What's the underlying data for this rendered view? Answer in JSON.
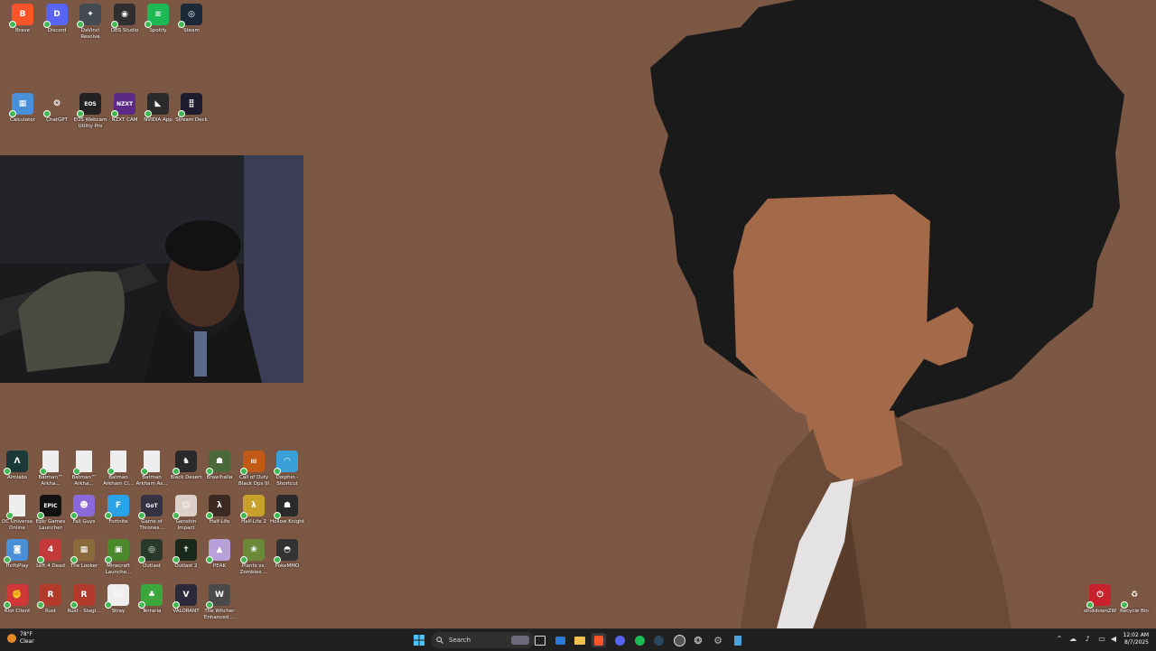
{
  "desktop": {
    "top_icons": [
      {
        "label": "Brave",
        "color": "#fb542b",
        "glyph": "B",
        "icon": "brave-icon"
      },
      {
        "label": "Discord",
        "color": "#5865f2",
        "glyph": "D",
        "icon": "discord-icon"
      },
      {
        "label": "DaVinci Resolve",
        "color": "#444a52",
        "glyph": "✦",
        "icon": "davinci-icon"
      },
      {
        "label": "OBS Studio",
        "color": "#302e31",
        "glyph": "◉",
        "icon": "obs-icon"
      },
      {
        "label": "Spotify",
        "color": "#1db954",
        "glyph": "≋",
        "icon": "spotify-icon"
      },
      {
        "label": "Steam",
        "color": "#1b2838",
        "glyph": "◎",
        "icon": "steam-icon"
      }
    ],
    "second_row_icons": [
      {
        "label": "Calculator",
        "color": "#4a90d9",
        "glyph": "▦",
        "icon": "calculator-icon"
      },
      {
        "label": "ChatGPT",
        "color": "#7b5744",
        "glyph": "❂",
        "icon": "chatgpt-icon"
      },
      {
        "label": "EOS Webcam Utility Pro",
        "color": "#222",
        "glyph": "EOS",
        "icon": "eos-webcam-icon"
      },
      {
        "label": "NZXT CAM",
        "color": "#5b2a86",
        "glyph": "NZXT",
        "icon": "nzxt-icon"
      },
      {
        "label": "NVIDIA App",
        "color": "#2b2b2b",
        "glyph": "◣",
        "icon": "nvidia-icon"
      },
      {
        "label": "Stream Deck",
        "color": "#1c1c2e",
        "glyph": "⣿",
        "icon": "stream-deck-icon"
      }
    ],
    "game_icons": [
      [
        {
          "label": "Aimlabs",
          "color": "#1a3a3a",
          "glyph": "Λ",
          "icon": "aimlabs-icon"
        },
        {
          "label": "Batman™ Arkha...",
          "color": "#eee",
          "glyph": "",
          "icon": "file-icon"
        },
        {
          "label": "Batman™ Arkha...",
          "color": "#eee",
          "glyph": "",
          "icon": "file-icon"
        },
        {
          "label": "Batman Arkham Ci...",
          "color": "#eee",
          "glyph": "",
          "icon": "file-icon"
        },
        {
          "label": "Batman Arkham As...",
          "color": "#eee",
          "glyph": "",
          "icon": "file-icon"
        },
        {
          "label": "Black Desert",
          "color": "#2a2a2a",
          "glyph": "♞",
          "icon": "black-desert-icon"
        },
        {
          "label": "Brawlhalla",
          "color": "#4a6a3a",
          "glyph": "☗",
          "icon": "brawlhalla-icon"
        },
        {
          "label": "Call of Duty Black Ops III",
          "color": "#c25a17",
          "glyph": "III",
          "icon": "cod-icon"
        },
        {
          "label": "Dolphin - Shortcut",
          "color": "#3aa0d8",
          "glyph": "◠",
          "icon": "dolphin-icon"
        }
      ],
      [
        {
          "label": "DC Universe Online",
          "color": "#eee",
          "glyph": "",
          "icon": "file-icon"
        },
        {
          "label": "Epic Games Launcher",
          "color": "#111",
          "glyph": "EPIC",
          "icon": "epic-games-icon"
        },
        {
          "label": "Fall Guys",
          "color": "#8a6ad8",
          "glyph": "☻",
          "icon": "fall-guys-icon"
        },
        {
          "label": "Fortnite",
          "color": "#2aa2e8",
          "glyph": "F",
          "icon": "fortnite-icon"
        },
        {
          "label": "Game of Thrones...",
          "color": "#334",
          "glyph": "GoT",
          "icon": "got-icon"
        },
        {
          "label": "Genshin Impact",
          "color": "#ddd0c8",
          "glyph": "☺",
          "icon": "genshin-icon"
        },
        {
          "label": "Half-Life",
          "color": "#3a2a22",
          "glyph": "λ",
          "icon": "half-life-icon"
        },
        {
          "label": "Half-Life 2",
          "color": "#c8a02a",
          "glyph": "λ",
          "icon": "half-life-2-icon"
        },
        {
          "label": "Hollow Knight",
          "color": "#2a2a2a",
          "glyph": "☗",
          "icon": "hollow-knight-icon"
        }
      ],
      [
        {
          "label": "HoYoPlay",
          "color": "#4a90d9",
          "glyph": "◙",
          "icon": "hoyoplay-icon"
        },
        {
          "label": "Left 4 Dead",
          "color": "#c23a3a",
          "glyph": "4",
          "icon": "left-4-dead-icon"
        },
        {
          "label": "The Looker",
          "color": "#8a6a3a",
          "glyph": "▦",
          "icon": "the-looker-icon"
        },
        {
          "label": "Minecraft Launche...",
          "color": "#4a8a2a",
          "glyph": "▣",
          "icon": "minecraft-icon"
        },
        {
          "label": "Outlast",
          "color": "#2a3a2a",
          "glyph": "◎",
          "icon": "outlast-icon"
        },
        {
          "label": "Outlast 2",
          "color": "#1a2a1a",
          "glyph": "✝",
          "icon": "outlast-2-icon"
        },
        {
          "label": "PEAK",
          "color": "#b8a0d8",
          "glyph": "▲",
          "icon": "peak-icon"
        },
        {
          "label": "Plants vs. Zombies ...",
          "color": "#6a8a3a",
          "glyph": "❀",
          "icon": "pvz-icon"
        },
        {
          "label": "PokeMMO",
          "color": "#333",
          "glyph": "◓",
          "icon": "pokemmo-icon"
        }
      ],
      [
        {
          "label": "Riot Client",
          "color": "#d13639",
          "glyph": "✊",
          "icon": "riot-client-icon"
        },
        {
          "label": "Rust",
          "color": "#b23a2a",
          "glyph": "R",
          "icon": "rust-icon"
        },
        {
          "label": "Rust - Stagi...",
          "color": "#b23a2a",
          "glyph": "R",
          "icon": "rust-staging-icon"
        },
        {
          "label": "Stray",
          "color": "#eee",
          "glyph": "🐱",
          "icon": "stray-icon"
        },
        {
          "label": "Terraria",
          "color": "#3aa83a",
          "glyph": "♣",
          "icon": "terraria-icon"
        },
        {
          "label": "VALORANT",
          "color": "#2a2a3a",
          "glyph": "V",
          "icon": "valorant-icon"
        },
        {
          "label": "The Witcher Enhanced ...",
          "color": "#4a4a4a",
          "glyph": "W",
          "icon": "witcher-icon"
        }
      ]
    ],
    "right_icons": [
      {
        "label": "shutdownZW",
        "color": "#c8232c",
        "glyph": "⏻",
        "icon": "shutdown-icon"
      },
      {
        "label": "Recycle Bin",
        "color": "#7b5744",
        "glyph": "♻",
        "icon": "recycle-bin-icon"
      }
    ]
  },
  "taskbar": {
    "weather_temp": "78°F",
    "weather_desc": "Clear",
    "search_placeholder": "Search",
    "time": "12:02 AM",
    "date": "8/7/2025"
  },
  "colors": {
    "wallpaper": "#7b5744",
    "hair": "#1a1a1a",
    "skin": "#a36a49",
    "jacket": "#6b4a37",
    "shirt": "#e4e2e2"
  }
}
